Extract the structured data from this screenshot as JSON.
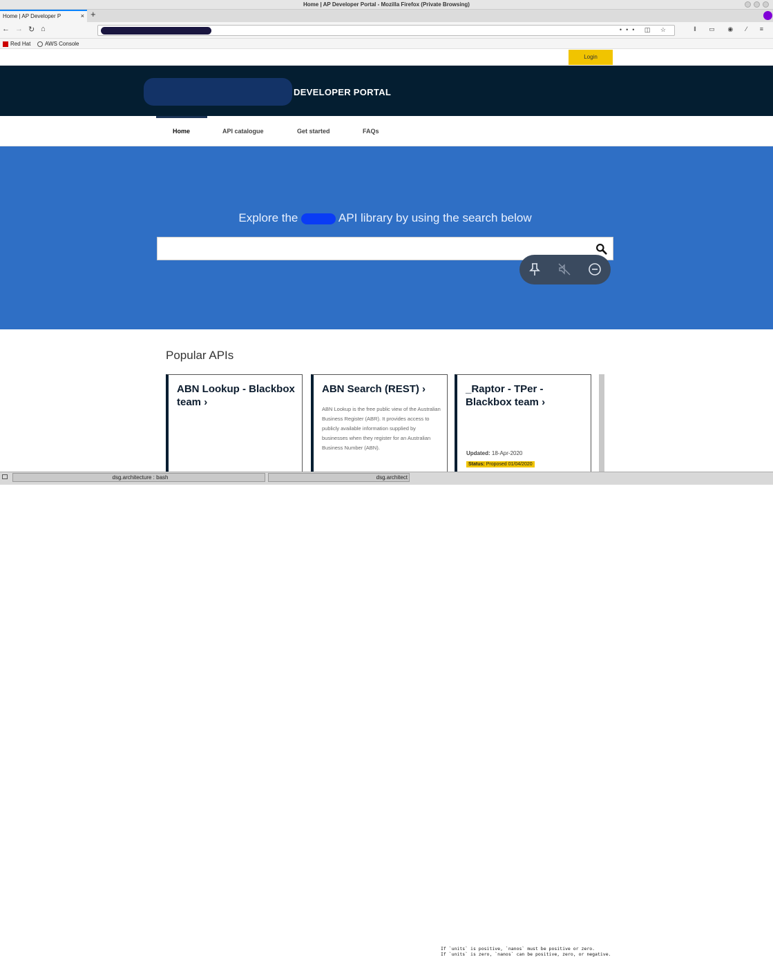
{
  "browser": {
    "window_title": "Home | AP Developer Portal - Mozilla Firefox (Private Browsing)",
    "tab_title": "Home | AP Developer P",
    "bookmarks": [
      "Red Hat",
      "AWS Console"
    ]
  },
  "site": {
    "login_label": "Login",
    "portal_title": "DEVELOPER PORTAL",
    "nav": [
      "Home",
      "API catalogue",
      "Get started",
      "FAQs"
    ],
    "hero_prefix": "Explore the ",
    "hero_suffix": " API library by using the search below",
    "search_placeholder": "",
    "popular_title": "Popular APIs"
  },
  "cards": [
    {
      "title": "ABN Lookup - Blackbox team",
      "chevron": "›",
      "description": "",
      "updated_label": "",
      "updated_value": "",
      "status_label": "",
      "status_value": ""
    },
    {
      "title": "ABN Search (REST)",
      "chevron": "›",
      "description": "ABN Lookup is the free public view of the Australian Business Register (ABR). It provides access to publicly available information supplied by businesses when they register for an Australian Business Number (ABN).",
      "updated_label": "",
      "updated_value": "",
      "status_label": "",
      "status_value": ""
    },
    {
      "title": "_Raptor - TPer - Blackbox team",
      "chevron": "›",
      "description": "",
      "updated_label": "Updated:",
      "updated_value": "18-Apr-2020",
      "status_label": "Status:",
      "status_value": "Proposed 01/04/2020"
    }
  ],
  "taskbar": {
    "task1": "dsg.architecture : bash",
    "task2": "dsg.architect",
    "terminal_line1": "If `units` is positive, `nanos` must be positive or zero.",
    "terminal_line2": "If `units` is zero, `nanos` can be positive, zero, or negative."
  },
  "colors": {
    "banner": "#041e31",
    "hero": "#2f6fc5",
    "login": "#f1c400",
    "accent": "#1d3557"
  }
}
